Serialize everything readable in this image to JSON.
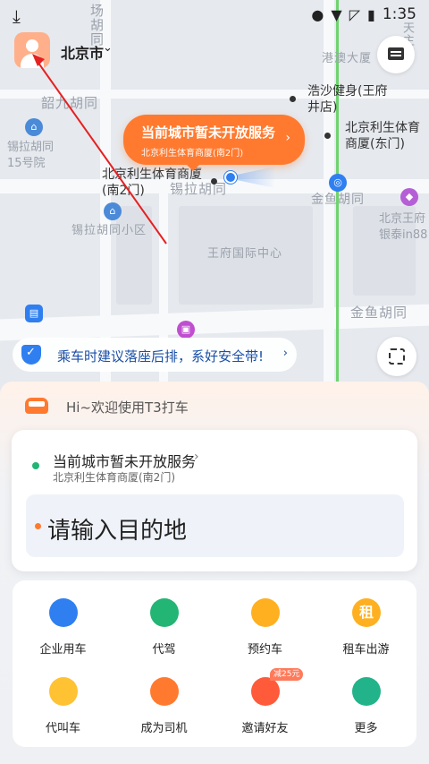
{
  "status_bar": {
    "time": "1:35"
  },
  "header": {
    "city": "北京市",
    "city_chevron": "⌄"
  },
  "map": {
    "street_labels": [
      "场胡同",
      "韶九胡同",
      "锡拉胡同",
      "锡拉胡同小区",
      "王府国际中心",
      "金鱼胡同",
      "金鱼胡同",
      "港澳大厦",
      "天主堂"
    ],
    "pois": [
      {
        "name": "浩沙健身(王府井店)"
      },
      {
        "name": "北京利生体育商厦(东门)"
      },
      {
        "name": "北京利生体育商厦(南2门)"
      },
      {
        "name": "锡拉胡同15号院"
      },
      {
        "name": "北京王府银泰in88"
      }
    ],
    "bubble": {
      "title": "当前城市暂未开放服务",
      "subtitle": "北京利生体育商厦(南2门)",
      "chevron": "›"
    }
  },
  "safety_banner": {
    "text": "乘车时建议落座后排，系好安全带!",
    "chevron": "›"
  },
  "sheet": {
    "greeting": "Hi~欢迎使用T3打车",
    "start": {
      "title": "当前城市暂未开放服务",
      "chevron": "›",
      "subtitle": "北京利生体育商厦(南2门)"
    },
    "destination_placeholder": "请输入目的地"
  },
  "services": [
    {
      "label": "企业用车",
      "icon": "building-icon",
      "color": "#2f7ff0"
    },
    {
      "label": "代驾",
      "icon": "chauffeur-icon",
      "color": "#22b573"
    },
    {
      "label": "预约车",
      "icon": "stopwatch-icon",
      "color": "#ffb020"
    },
    {
      "label": "租车出游",
      "icon": "rental-icon",
      "color": "#ffb020",
      "icon_text": "租"
    },
    {
      "label": "代叫车",
      "icon": "call-car-icon",
      "color": "#ffc233"
    },
    {
      "label": "成为司机",
      "icon": "driver-icon",
      "color": "#ff7a2f"
    },
    {
      "label": "邀请好友",
      "icon": "invite-icon",
      "color": "#ff5a3a",
      "badge": "减25元"
    },
    {
      "label": "更多",
      "icon": "more-icon",
      "color": "#22b38a"
    }
  ],
  "colors": {
    "accent_orange": "#ff7a2f",
    "accent_blue": "#2f7ff0",
    "accent_green": "#22b573"
  }
}
